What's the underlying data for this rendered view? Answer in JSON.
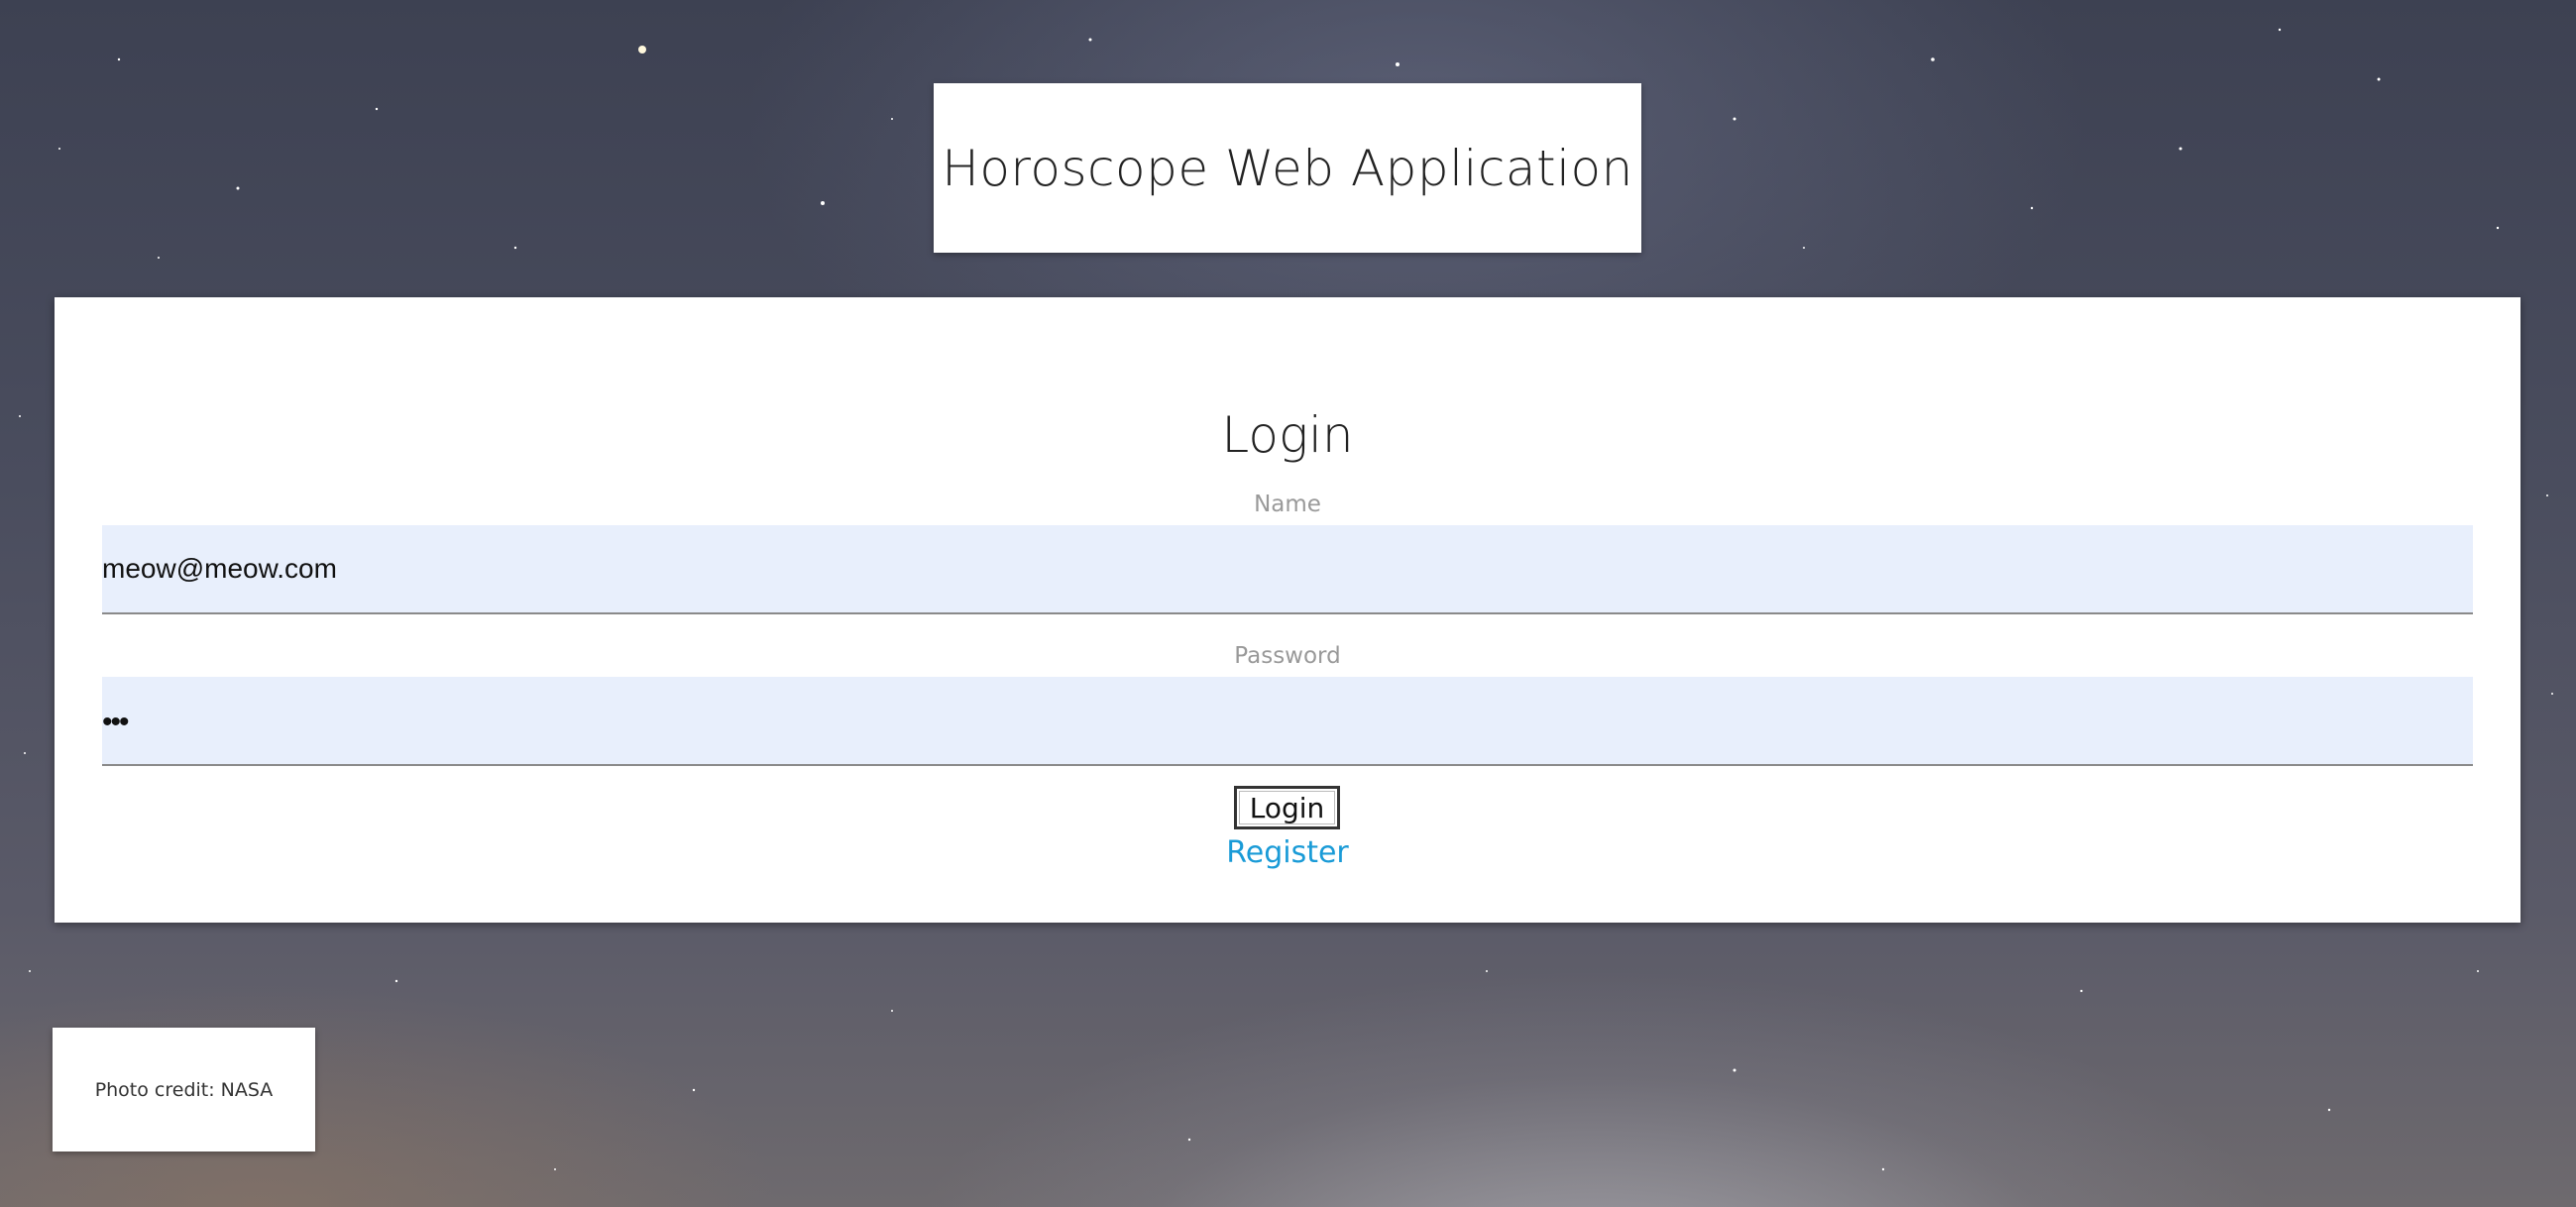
{
  "header": {
    "title": "Horoscope Web Application"
  },
  "login_form": {
    "heading": "Login",
    "name_label": "Name",
    "name_value": "meow@meow.com",
    "password_label": "Password",
    "password_value": "•••",
    "login_button_label": "Login",
    "register_link_label": "Register"
  },
  "footer": {
    "photo_credit": "Photo credit: NASA"
  },
  "colors": {
    "link": "#1a9bd7",
    "input_background": "#e8effc"
  }
}
